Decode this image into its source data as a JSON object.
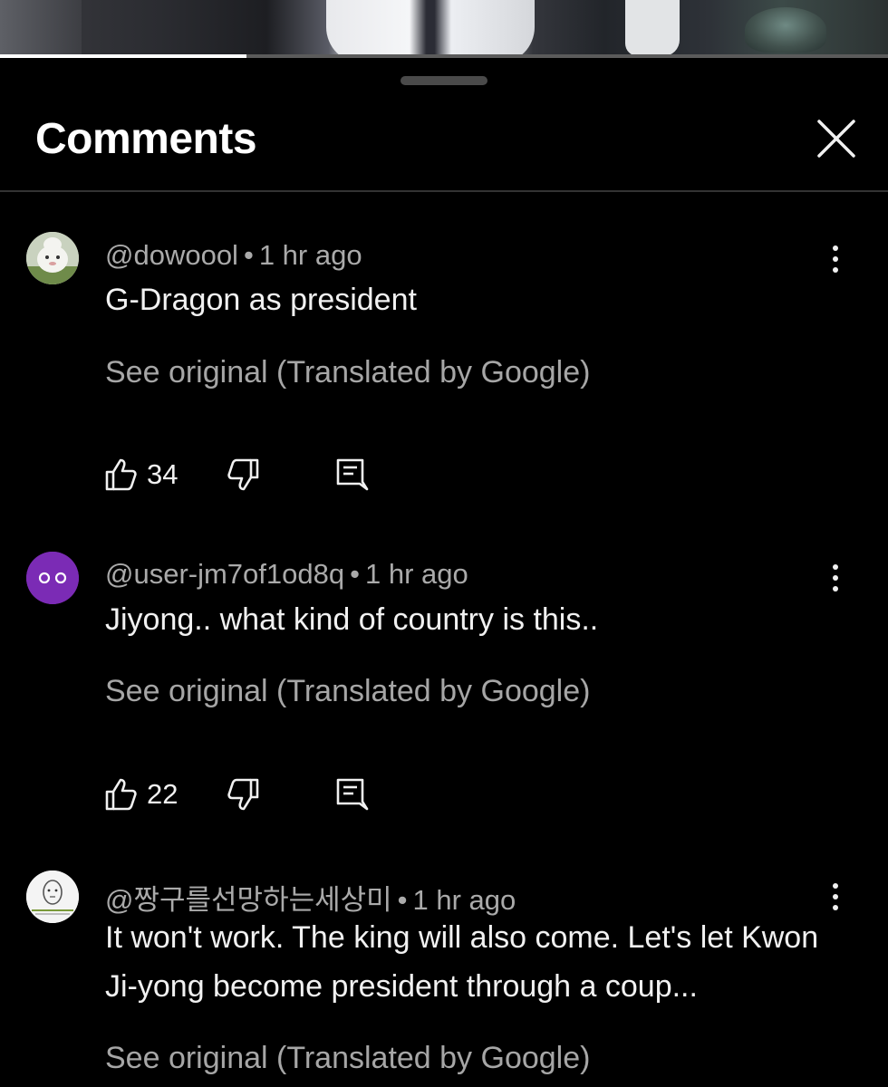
{
  "video": {
    "progress_fraction": 0.278
  },
  "header": {
    "title": "Comments",
    "close_icon": "close-icon"
  },
  "comments": [
    {
      "handle": "@dowoool",
      "separator": "•",
      "time": "1 hr ago",
      "text": "G-Dragon as president",
      "see_original": "See original (Translated by Google)",
      "likes": "34",
      "avatar_icon": "avatar-cartoon-icon"
    },
    {
      "handle": "@user-jm7of1od8q",
      "separator": "•",
      "time": "1 hr ago",
      "text": "Jiyong.. what kind of country is this..",
      "see_original": "See original (Translated by Google)",
      "likes": "22",
      "avatar_color": "#7b2bb5",
      "avatar_icon": "avatar-eyes-icon"
    },
    {
      "handle": "@짱구를선망하는세상미",
      "separator": "•",
      "time": "1 hr ago",
      "text": "It won't work. The king will also come. Let's let Kwon Ji-yong become president through a coup...",
      "see_original": "See original (Translated by Google)",
      "avatar_icon": "avatar-sketch-icon"
    }
  ],
  "icons": {
    "like": "thumbs-up-icon",
    "dislike": "thumbs-down-icon",
    "reply": "reply-icon",
    "more": "more-vertical-icon"
  },
  "colors": {
    "background": "#000000",
    "text_primary": "#f1f1f1",
    "text_secondary": "#aaaaaa",
    "avatar_purple": "#7b2bb5"
  }
}
